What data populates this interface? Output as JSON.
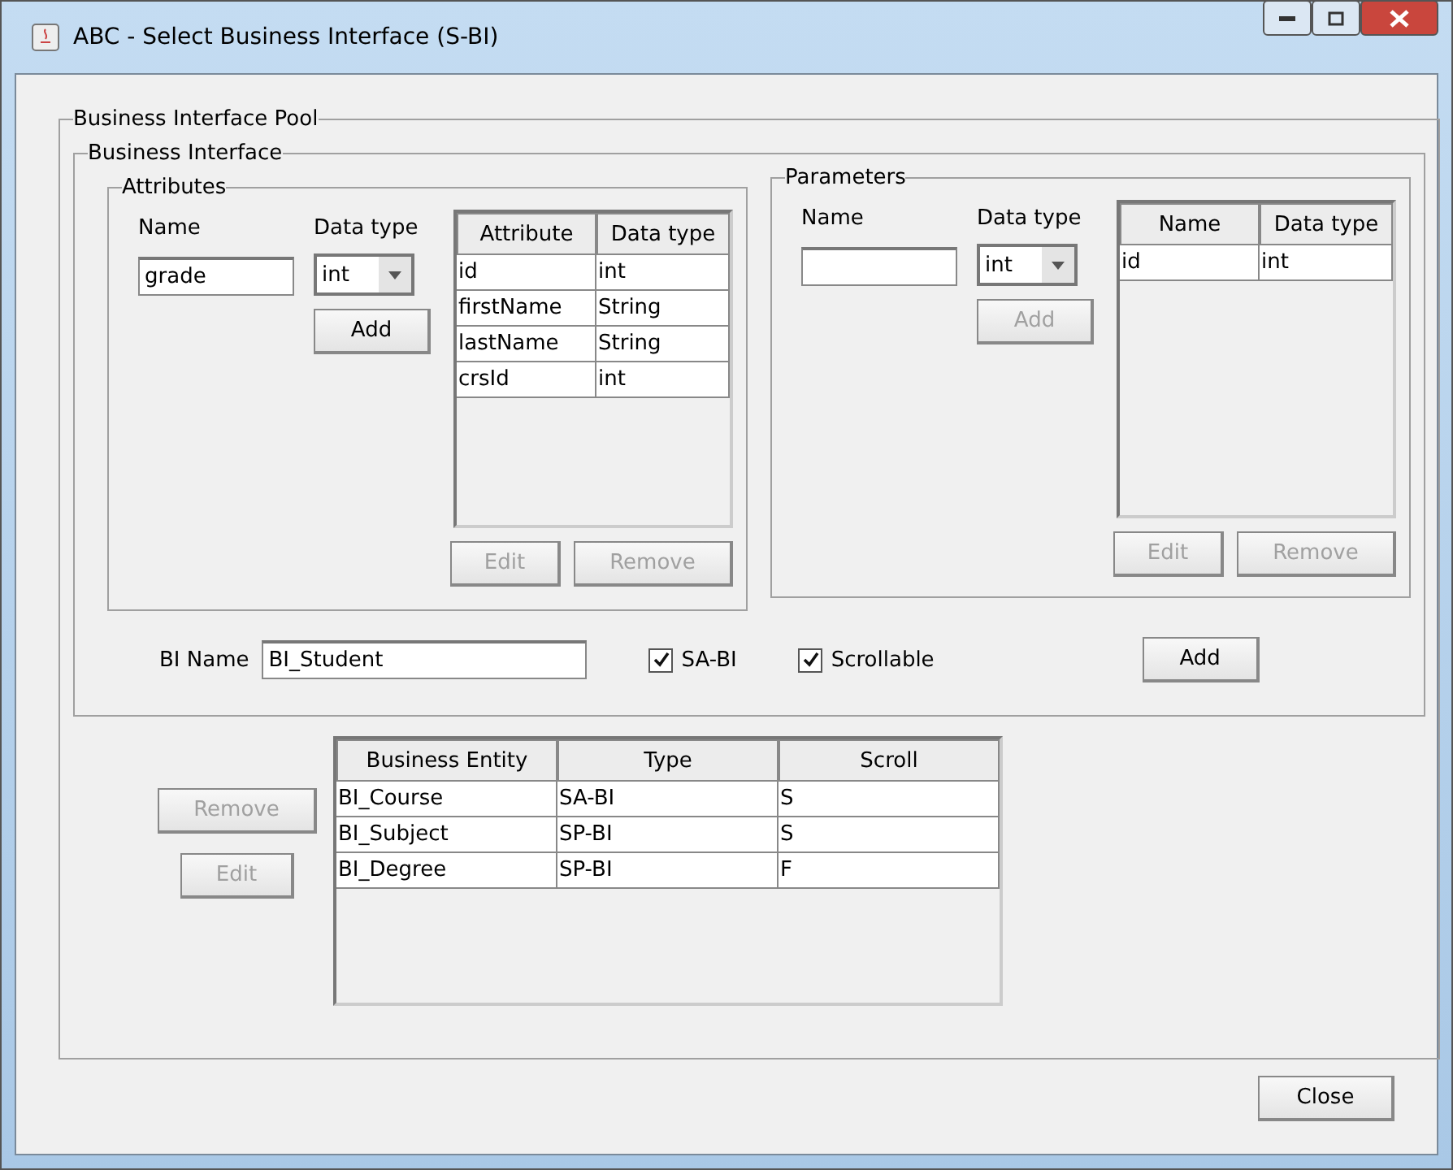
{
  "window": {
    "title": "ABC - Select Business Interface (S-BI)"
  },
  "pool": {
    "title": "Business Interface Pool"
  },
  "business_interface": {
    "title": "Business Interface",
    "attributes": {
      "title": "Attributes",
      "name_label": "Name",
      "name_value": "grade",
      "type_label": "Data type",
      "type_value": "int",
      "add": {
        "label": "Add",
        "disabled": false
      },
      "columns": [
        "Attribute",
        "Data type"
      ],
      "rows": [
        [
          "id",
          "int"
        ],
        [
          "firstName",
          "String"
        ],
        [
          "lastName",
          "String"
        ],
        [
          "crsId",
          "int"
        ]
      ],
      "edit": {
        "label": "Edit",
        "disabled": true
      },
      "remove": {
        "label": "Remove",
        "disabled": true
      }
    },
    "parameters": {
      "title": "Parameters",
      "name_label": "Name",
      "type_label": "Data type",
      "type_value": "int",
      "add": {
        "label": "Add",
        "disabled": true
      },
      "columns": [
        "Name",
        "Data type"
      ],
      "rows": [
        [
          "id",
          "int"
        ]
      ],
      "edit": {
        "label": "Edit",
        "disabled": true
      },
      "remove": {
        "label": "Remove",
        "disabled": true
      }
    },
    "bi_name_label": "BI Name",
    "bi_name_value": "BI_Student",
    "checkboxes": [
      {
        "label": "SA-BI",
        "checked": true
      },
      {
        "label": "Scrollable",
        "checked": true
      }
    ],
    "add": {
      "label": "Add",
      "disabled": false
    }
  },
  "entities": {
    "remove": {
      "label": "Remove",
      "disabled": true
    },
    "edit": {
      "label": "Edit",
      "disabled": true
    },
    "columns": [
      "Business Entity",
      "Type",
      "Scroll"
    ],
    "rows": [
      [
        "BI_Course",
        "SA-BI",
        "S"
      ],
      [
        "BI_Subject",
        "SP-BI",
        "S"
      ],
      [
        "BI_Degree",
        "SP-BI",
        "F"
      ]
    ]
  },
  "close": {
    "label": "Close",
    "disabled": false
  }
}
